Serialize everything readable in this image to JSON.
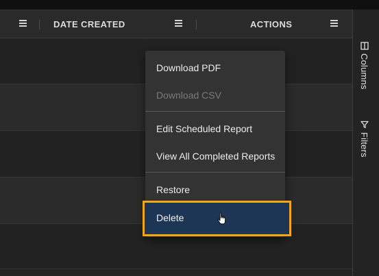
{
  "header": {
    "columns": [
      {
        "label": ""
      },
      {
        "label": "DATE CREATED"
      },
      {
        "label": "ACTIONS"
      }
    ]
  },
  "sidebar": {
    "tabs": [
      {
        "label": "Columns",
        "icon": "columns-icon"
      },
      {
        "label": "Filters",
        "icon": "filter-icon"
      }
    ]
  },
  "actions_menu": {
    "items": [
      {
        "label": "Download PDF",
        "enabled": true
      },
      {
        "label": "Download CSV",
        "enabled": false
      },
      {
        "label": "Edit Scheduled Report",
        "enabled": true
      },
      {
        "label": "View All Completed Reports",
        "enabled": true
      },
      {
        "label": "Restore",
        "enabled": true
      },
      {
        "label": "Delete",
        "enabled": true,
        "highlighted": true
      }
    ]
  },
  "colors": {
    "highlight_border": "#f3a712",
    "highlight_fill": "#1e3655",
    "menu_bg": "#333333",
    "grid_bg": "#232323"
  }
}
